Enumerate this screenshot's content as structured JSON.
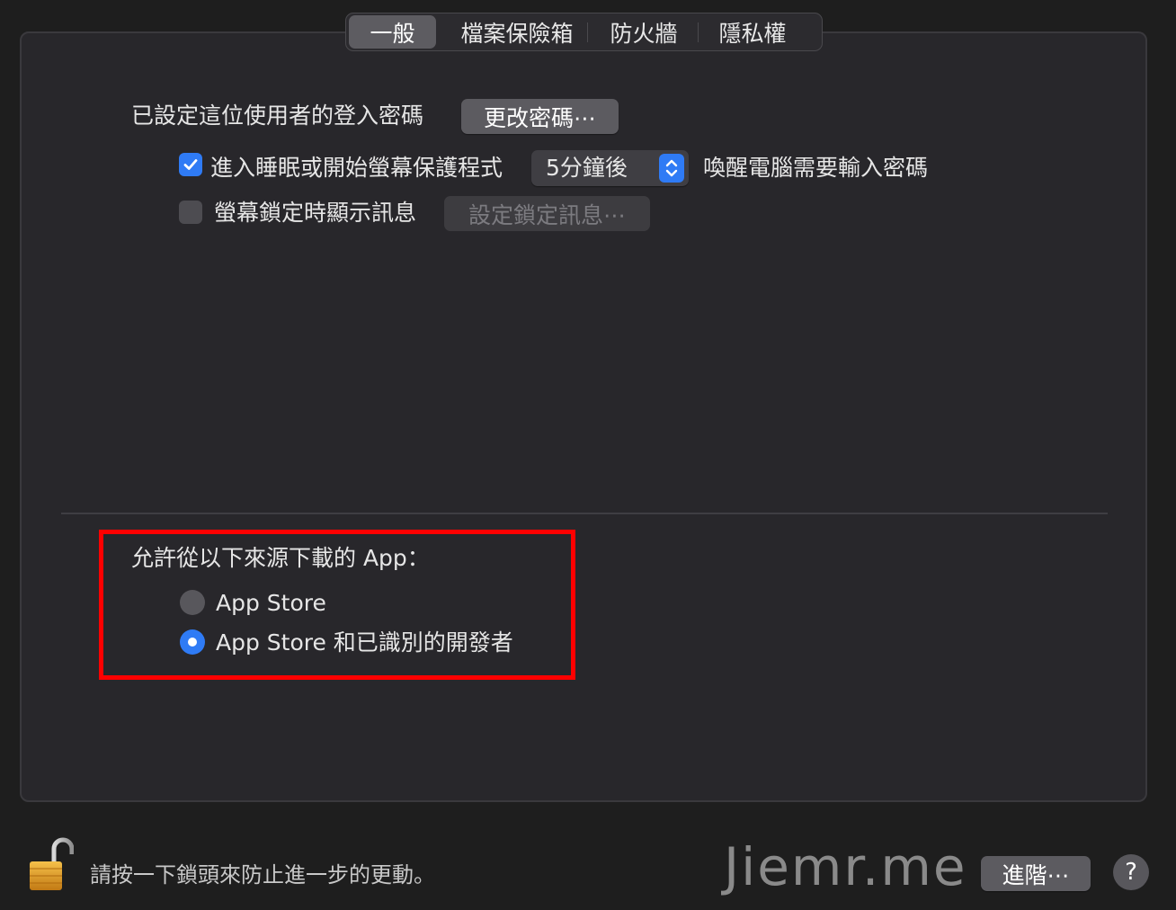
{
  "tabs": [
    {
      "label": "一般",
      "selected": true
    },
    {
      "label": "檔案保險箱",
      "selected": false
    },
    {
      "label": "防火牆",
      "selected": false
    },
    {
      "label": "隱私權",
      "selected": false
    }
  ],
  "general": {
    "password_set_label": "已設定這位使用者的登入密碼",
    "change_password_button": "更改密碼⋯",
    "require_password": {
      "checked": true,
      "label": "進入睡眠或開始螢幕保護程式",
      "delay_value": "5分鐘後",
      "suffix_label": "喚醒電腦需要輸入密碼"
    },
    "lock_message": {
      "checked": false,
      "label": "螢幕鎖定時顯示訊息",
      "button": "設定鎖定訊息⋯"
    }
  },
  "downloads": {
    "heading": "允許從以下來源下載的 App：",
    "options": [
      {
        "label": "App Store",
        "selected": false
      },
      {
        "label": "App Store 和已識別的開發者",
        "selected": true
      }
    ]
  },
  "footer": {
    "lock_hint": "請按一下鎖頭來防止進一步的更動。",
    "watermark": "Jiemr.me",
    "advanced_button": "進階⋯",
    "help_label": "?"
  },
  "colors": {
    "accent": "#2f7bf5",
    "highlight": "#ff0000"
  }
}
